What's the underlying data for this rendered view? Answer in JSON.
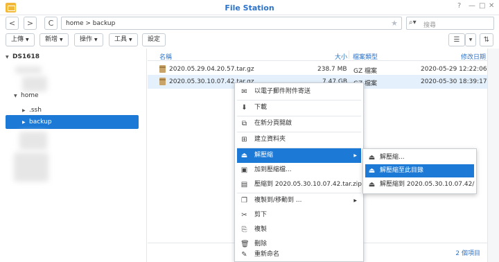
{
  "window": {
    "title": "File Station"
  },
  "nav": {
    "back": "<",
    "forward": ">",
    "refresh": "C",
    "path": "home > backup",
    "search_placeholder": "搜尋"
  },
  "toolbar": {
    "upload": "上傳",
    "create": "新增",
    "action": "操作",
    "tools": "工具",
    "settings": "設定"
  },
  "sidebar": {
    "root": "DS1618",
    "home": "home",
    "ssh": ".ssh",
    "backup": "backup"
  },
  "table": {
    "headers": {
      "name": "名稱",
      "size": "大小",
      "type": "檔案類型",
      "modified": "修改日期"
    },
    "rows": [
      {
        "name": "2020.05.29.04.20.57.tar.gz",
        "size": "238.7 MB",
        "type": "GZ 檔案",
        "modified": "2020-05-29 12:22:06"
      },
      {
        "name": "2020.05.30.10.07.42.tar.gz",
        "size": "7.47 GB",
        "type": "GZ 檔案",
        "modified": "2020-05-30 18:39:17"
      }
    ],
    "count": "2 個項目"
  },
  "context_menu": {
    "email": "以電子郵件附件寄送",
    "download": "下載",
    "open_new_tab": "在新分頁開啟",
    "create_folder": "建立資料夾",
    "extract": "解壓縮",
    "add_archive": "加到壓縮檔...",
    "compress_to": "壓縮到 2020.05.30.10.07.42.tar.zip",
    "copy_move": "複製到/移動到 ...",
    "cut": "剪下",
    "copy": "複製",
    "delete": "刪除",
    "rename": "重新命名"
  },
  "submenu": {
    "extract_dialog": "解壓縮...",
    "extract_here": "解壓縮至此目錄",
    "extract_to": "解壓縮到 2020.05.30.10.07.42/"
  },
  "colors": {
    "accent": "#1c7ad6",
    "title": "#2b73c9",
    "selected_row": "#e4f0fc"
  }
}
